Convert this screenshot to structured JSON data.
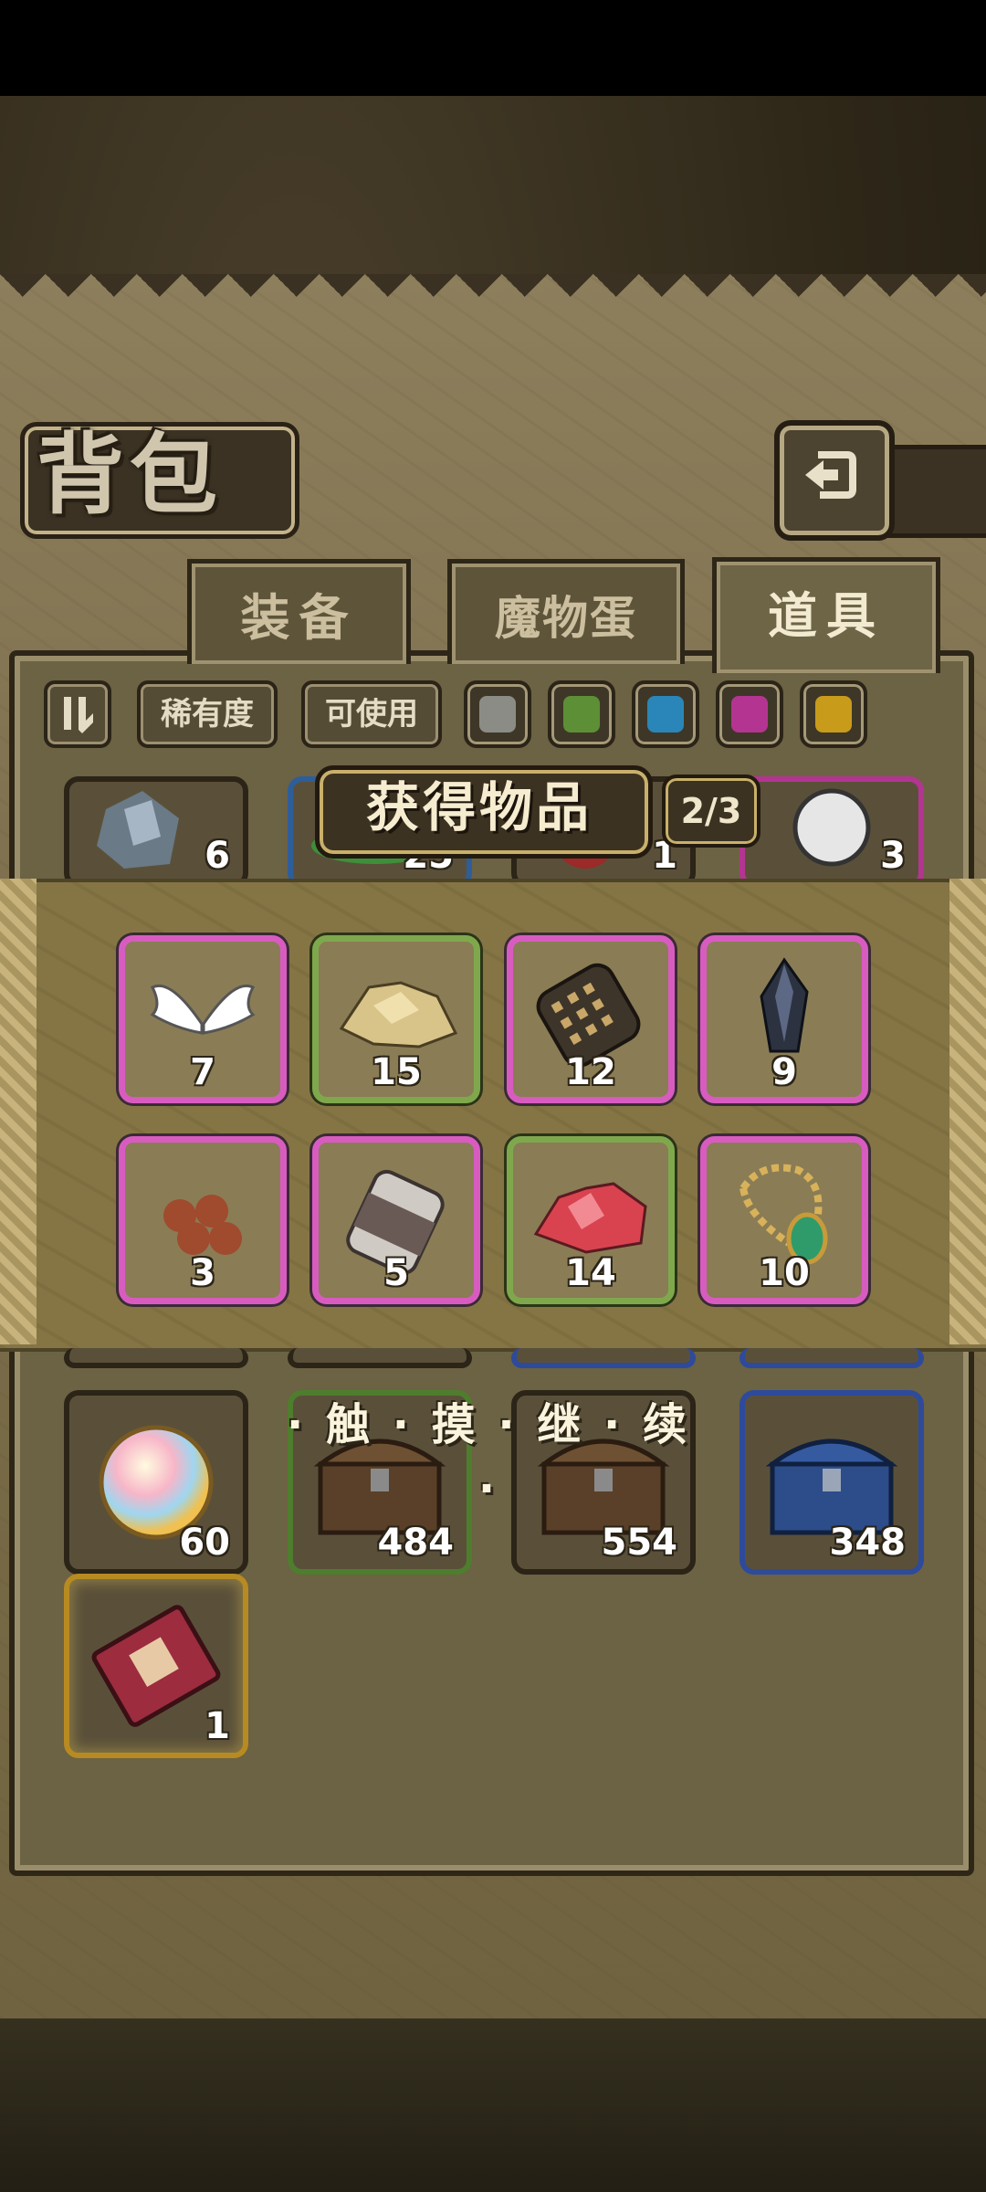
{
  "screen": {
    "title": "背包"
  },
  "tabs": [
    {
      "label": "装备",
      "active": false
    },
    {
      "label": "魔物蛋",
      "active": false
    },
    {
      "label": "道具",
      "active": true
    }
  ],
  "filters": {
    "rarity": "稀有度",
    "usable": "可使用"
  },
  "color_filters": [
    {
      "name": "gray",
      "color": "#8c8c86"
    },
    {
      "name": "green",
      "color": "#5d8f36"
    },
    {
      "name": "blue",
      "color": "#2a86b8"
    },
    {
      "name": "purple",
      "color": "#b43591"
    },
    {
      "name": "gold",
      "color": "#c99b1a"
    }
  ],
  "popup": {
    "title": "获得物品",
    "page": "2/3",
    "items": [
      {
        "name": "angel-wings",
        "count": "7",
        "rarity": "purple"
      },
      {
        "name": "gold-ore",
        "count": "15",
        "rarity": "green"
      },
      {
        "name": "iron-cylinder",
        "count": "12",
        "rarity": "purple"
      },
      {
        "name": "dark-crystal",
        "count": "9",
        "rarity": "purple"
      },
      {
        "name": "brown-beads",
        "count": "3",
        "rarity": "purple"
      },
      {
        "name": "metal-canister",
        "count": "5",
        "rarity": "purple"
      },
      {
        "name": "red-crystals",
        "count": "14",
        "rarity": "green"
      },
      {
        "name": "emerald-necklace",
        "count": "10",
        "rarity": "purple"
      }
    ]
  },
  "inventory": {
    "top_partial": [
      {
        "name": "crystal-cluster",
        "count": "6"
      },
      {
        "name": "green-leaf",
        "count": "25"
      },
      {
        "name": "red-bag",
        "count": "1"
      },
      {
        "name": "white-pearl",
        "count": "3"
      }
    ],
    "items": [
      {
        "name": "rainbow-orb",
        "count": "60"
      },
      {
        "name": "wooden-chest-green",
        "count": "484"
      },
      {
        "name": "wooden-chest",
        "count": "554"
      },
      {
        "name": "blue-chest",
        "count": "348"
      },
      {
        "name": "red-ticket",
        "count": "1"
      }
    ]
  },
  "hint": "· 触 · 摸 · 继 · 续 ·"
}
